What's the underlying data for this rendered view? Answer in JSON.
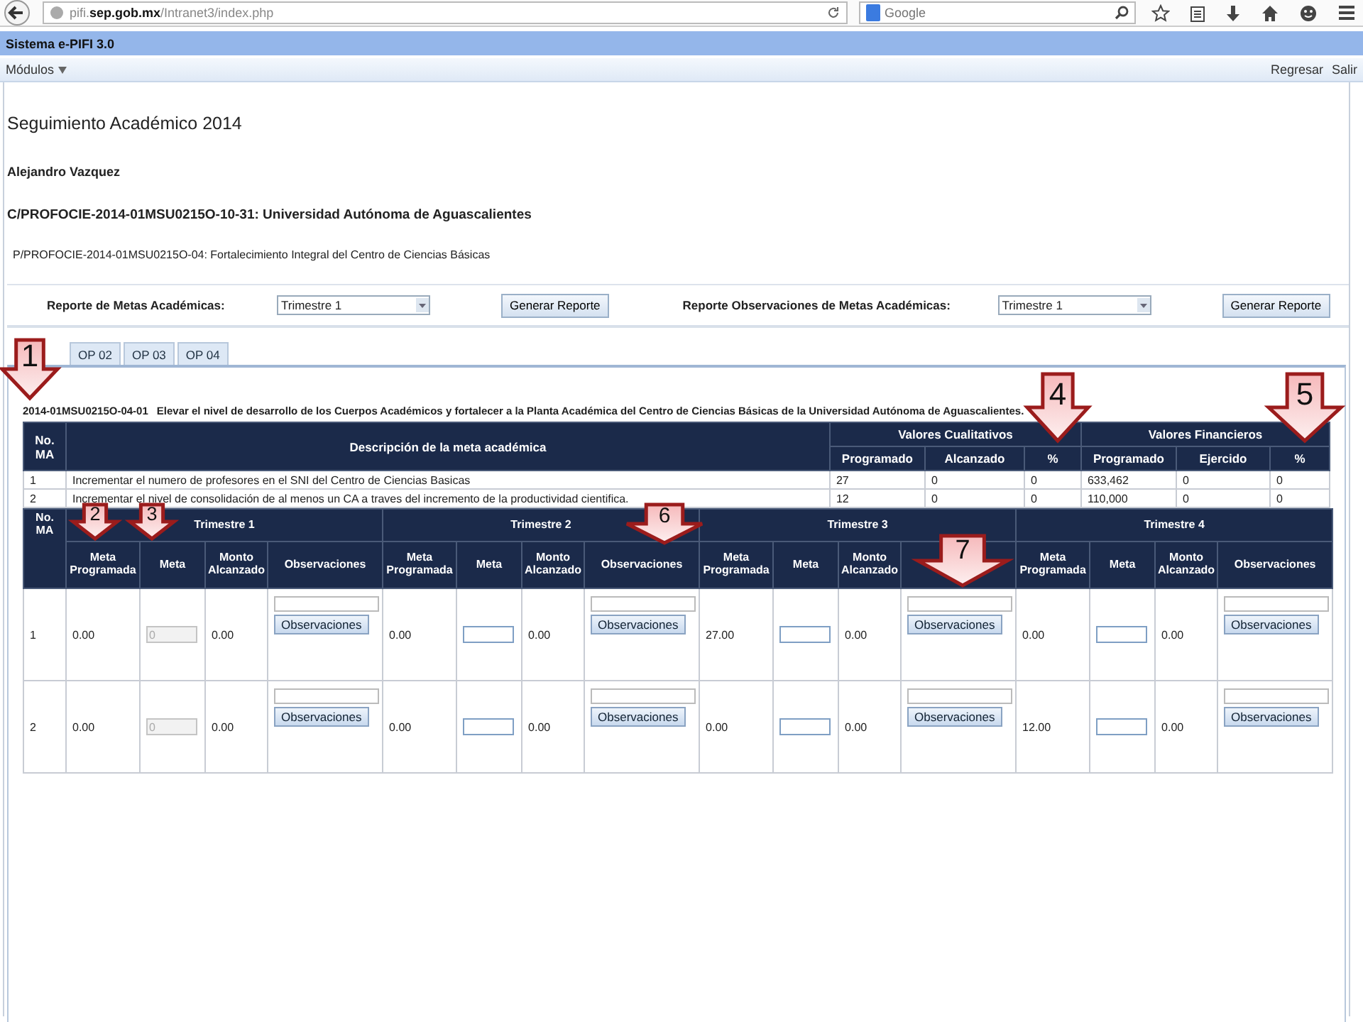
{
  "browser": {
    "url": "pifi.**sep.gob.mx**/Intranet3/index.php",
    "search_placeholder": "Google"
  },
  "app_bar": {
    "title": "Sistema e-PIFI 3.0"
  },
  "menu": {
    "left": "Módulos",
    "right": [
      "Regresar",
      "Salir"
    ]
  },
  "page": {
    "title": "Seguimiento Académico 2014",
    "user": "Alejandro Vazquez",
    "c_project": "C/PROFOCIE-2014-01MSU0215O-10-31: Universidad Autónoma de Aguascalientes",
    "p_project": "P/PROFOCIE-2014-01MSU0215O-04: Fortalecimiento Integral del Centro de Ciencias Básicas"
  },
  "reports": [
    {
      "label": "Reporte de Metas Académicas:",
      "select_value": "Trimestre 1",
      "button": "Generar Reporte"
    },
    {
      "label": "Reporte Observaciones de Metas Académicas:",
      "select_value": "Trimestre 1",
      "button": "Generar Reporte"
    }
  ],
  "tabs": [
    {
      "label": "OP 02",
      "selected": false
    },
    {
      "label": "OP 03",
      "selected": false
    },
    {
      "label": "OP 04",
      "selected": false
    }
  ],
  "goal": {
    "code": "2014-01MSU0215O-04-01",
    "description": "Elevar el nivel de desarrollo de los Cuerpos Académicos y fortalecer a la Planta Académica del Centro de Ciencias Básicas de la Universidad Autónoma de Aguascalientes."
  },
  "summary_table": {
    "col_no": "No. MA",
    "col_desc": "Descripción de la meta académica",
    "groups": [
      "Valores Cualitativos",
      "Valores Financieros"
    ],
    "subcolumns": [
      "Programado",
      "Alcanzado",
      "%",
      "Programado",
      "Ejercido",
      "%"
    ],
    "rows": [
      {
        "no": "1",
        "description": "Incrementar el numero de profesores en el SNI del Centro de Ciencias Basicas",
        "values": [
          "27",
          "0",
          "0",
          "633,462",
          "0",
          "0"
        ]
      },
      {
        "no": "2",
        "description": "Incrementar el nivel de consolidación de al menos un CA a traves del incremento de la productividad cientifica.",
        "values": [
          "12",
          "0",
          "0",
          "110,000",
          "0",
          "0"
        ]
      }
    ]
  },
  "detail_table": {
    "col_no": "No. MA",
    "quarters": [
      {
        "title": "Trimestre 1",
        "subcolumns": [
          "Meta Programada",
          "Meta",
          "Monto Alcanzado",
          "Observaciones"
        ]
      },
      {
        "title": "Trimestre 2",
        "subcolumns": [
          "Meta Programada",
          "Meta",
          "Monto Alcanzado",
          "Observaciones"
        ]
      },
      {
        "title": "Trimestre 3",
        "subcolumns": [
          "Meta Programada",
          "Meta",
          "Monto Alcanzado"
        ]
      },
      {
        "title": "Trimestre 4",
        "subcolumns": [
          "Meta Programada",
          "Meta",
          "Monto Alcanzado",
          "Observaciones"
        ]
      }
    ],
    "rows": [
      {
        "no": "1",
        "cells": [
          {
            "programada": "0.00",
            "meta": "0",
            "disabled": true,
            "monto": "0.00",
            "button": "Observaciones"
          },
          {
            "programada": "0.00",
            "disabled": false,
            "monto": "0.00",
            "button": "Observaciones"
          },
          {
            "programada": "27.00",
            "disabled": false,
            "monto": "0.00",
            "button": "Observaciones"
          },
          {
            "programada": "0.00",
            "disabled": false,
            "monto": "0.00",
            "button": "Observaciones"
          }
        ]
      },
      {
        "no": "2",
        "cells": [
          {
            "programada": "0.00",
            "meta": "0",
            "disabled": true,
            "monto": "0.00",
            "button": "Observaciones"
          },
          {
            "programada": "0.00",
            "disabled": false,
            "monto": "0.00",
            "button": "Observaciones"
          },
          {
            "programada": "0.00",
            "disabled": false,
            "monto": "0.00",
            "button": "Observaciones"
          },
          {
            "programada": "12.00",
            "disabled": false,
            "monto": "0.00",
            "button": "Observaciones"
          }
        ]
      }
    ]
  },
  "callouts": [
    {
      "number": "1"
    },
    {
      "number": "2"
    },
    {
      "number": "3"
    },
    {
      "number": "4"
    },
    {
      "number": "5"
    },
    {
      "number": "6"
    },
    {
      "number": "7"
    }
  ]
}
